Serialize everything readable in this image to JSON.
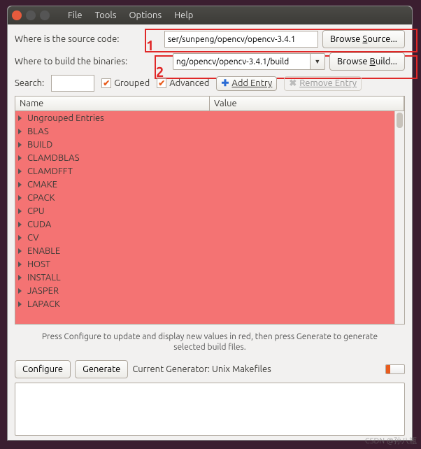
{
  "menu": {
    "file": "File",
    "tools": "Tools",
    "options": "Options",
    "help": "Help"
  },
  "markers": {
    "one": "1",
    "two": "2"
  },
  "source": {
    "label": "Where is the source code:",
    "value": "ser/sunpeng/opencv/opencv-3.4.1",
    "browse": "Browse Source..."
  },
  "build": {
    "label": "Where to build the binaries:",
    "value": "ng/opencv/opencv-3.4.1/build",
    "browse": "Browse Build..."
  },
  "toolbar": {
    "search_label": "Search:",
    "search_value": "",
    "grouped": "Grouped",
    "advanced": "Advanced",
    "add_entry": "Add Entry",
    "remove_entry": "Remove Entry"
  },
  "table": {
    "headers": {
      "name": "Name",
      "value": "Value"
    },
    "rows": [
      "Ungrouped Entries",
      "BLAS",
      "BUILD",
      "CLAMDBLAS",
      "CLAMDFFT",
      "CMAKE",
      "CPACK",
      "CPU",
      "CUDA",
      "CV",
      "ENABLE",
      "HOST",
      "INSTALL",
      "JASPER",
      "LAPACK"
    ]
  },
  "hint": "Press Configure to update and display new values in red, then press Generate to generate selected build files.",
  "buttons": {
    "configure": "Configure",
    "generate": "Generate"
  },
  "generator": {
    "label": "Current Generator: Unix Makefiles"
  },
  "watermark": "CSDN @孙八瓶"
}
